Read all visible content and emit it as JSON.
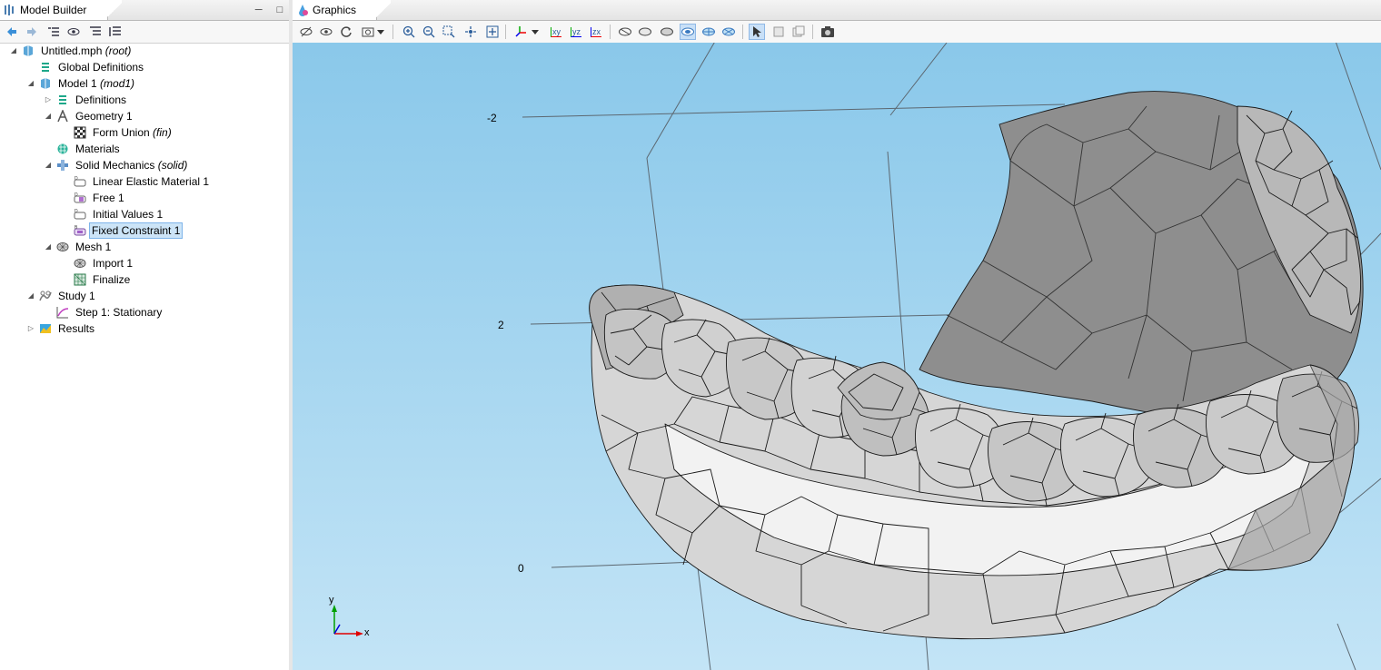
{
  "model_builder": {
    "title": "Model Builder",
    "toolbar_icons": [
      "back-arrow-icon",
      "forward-arrow-icon",
      "expand-sections-icon",
      "show-icon",
      "collapse-all-icon",
      "expand-all-icon"
    ],
    "tree": [
      {
        "label": "Untitled.mph",
        "suffix": "(root)",
        "level": 0,
        "expander": "expanded",
        "icon": "mph-file-icon"
      },
      {
        "label": "Global Definitions",
        "suffix": "",
        "level": 1,
        "expander": "none",
        "icon": "global-definitions-icon"
      },
      {
        "label": "Model 1",
        "suffix": "(mod1)",
        "level": 1,
        "expander": "expanded",
        "icon": "model-icon"
      },
      {
        "label": "Definitions",
        "suffix": "",
        "level": 2,
        "expander": "collapsed",
        "icon": "definitions-icon"
      },
      {
        "label": "Geometry 1",
        "suffix": "",
        "level": 2,
        "expander": "expanded",
        "icon": "geometry-icon"
      },
      {
        "label": "Form Union",
        "suffix": "(fin)",
        "level": 3,
        "expander": "none",
        "icon": "form-union-icon"
      },
      {
        "label": "Materials",
        "suffix": "",
        "level": 2,
        "expander": "none",
        "icon": "materials-icon"
      },
      {
        "label": "Solid Mechanics",
        "suffix": "(solid)",
        "level": 2,
        "expander": "expanded",
        "icon": "solid-mechanics-icon"
      },
      {
        "label": "Linear Elastic Material 1",
        "suffix": "",
        "level": 3,
        "expander": "none",
        "icon": "domain-feature-icon"
      },
      {
        "label": "Free 1",
        "suffix": "",
        "level": 3,
        "expander": "none",
        "icon": "free-feature-icon"
      },
      {
        "label": "Initial Values 1",
        "suffix": "",
        "level": 3,
        "expander": "none",
        "icon": "domain-feature-icon"
      },
      {
        "label": "Fixed Constraint 1",
        "suffix": "",
        "level": 3,
        "expander": "none",
        "icon": "fixed-constraint-icon",
        "selected": true
      },
      {
        "label": "Mesh 1",
        "suffix": "",
        "level": 2,
        "expander": "expanded",
        "icon": "mesh-icon"
      },
      {
        "label": "Import 1",
        "suffix": "",
        "level": 3,
        "expander": "none",
        "icon": "mesh-import-icon"
      },
      {
        "label": "Finalize",
        "suffix": "",
        "level": 3,
        "expander": "none",
        "icon": "mesh-finalize-icon"
      },
      {
        "label": "Study 1",
        "suffix": "",
        "level": 1,
        "expander": "expanded",
        "icon": "study-icon"
      },
      {
        "label": "Step 1: Stationary",
        "suffix": "",
        "level": 2,
        "expander": "none",
        "icon": "stationary-step-icon"
      },
      {
        "label": "Results",
        "suffix": "",
        "level": 1,
        "expander": "collapsed",
        "icon": "results-icon"
      }
    ]
  },
  "graphics": {
    "title": "Graphics",
    "toolbar_icons": [
      "hide-icon",
      "show-icon",
      "reset-view-icon",
      "camera-view-icon",
      "dropdown-icon",
      "zoom-in-icon",
      "zoom-out-icon",
      "zoom-box-icon",
      "zoom-selection-icon",
      "zoom-extents-icon",
      "axes-view-icon",
      "dropdown-icon",
      "xy-view-icon",
      "yz-view-icon",
      "zx-view-icon",
      "wireframe-icon",
      "transparency-icon",
      "render-surface-icon",
      "render-active-icon",
      "render-mesh-icon",
      "select-arrow-icon",
      "select-box-icon",
      "deselect-icon",
      "screenshot-camera-icon"
    ],
    "xy_label": "xy",
    "yz_label": "yz",
    "zx_label": "zx",
    "axis_tick_labels": [
      "-2",
      "2",
      "0"
    ],
    "triad": {
      "y": "y",
      "x": "x"
    },
    "colors": {
      "background_top": "#8ac8ea",
      "background_bottom": "#c3e4f6",
      "surface": "#c8c8c8",
      "mesh_edge": "#1a1a1a",
      "triad_x": "#e00000",
      "triad_y": "#00a000",
      "triad_z": "#0000e0"
    }
  }
}
